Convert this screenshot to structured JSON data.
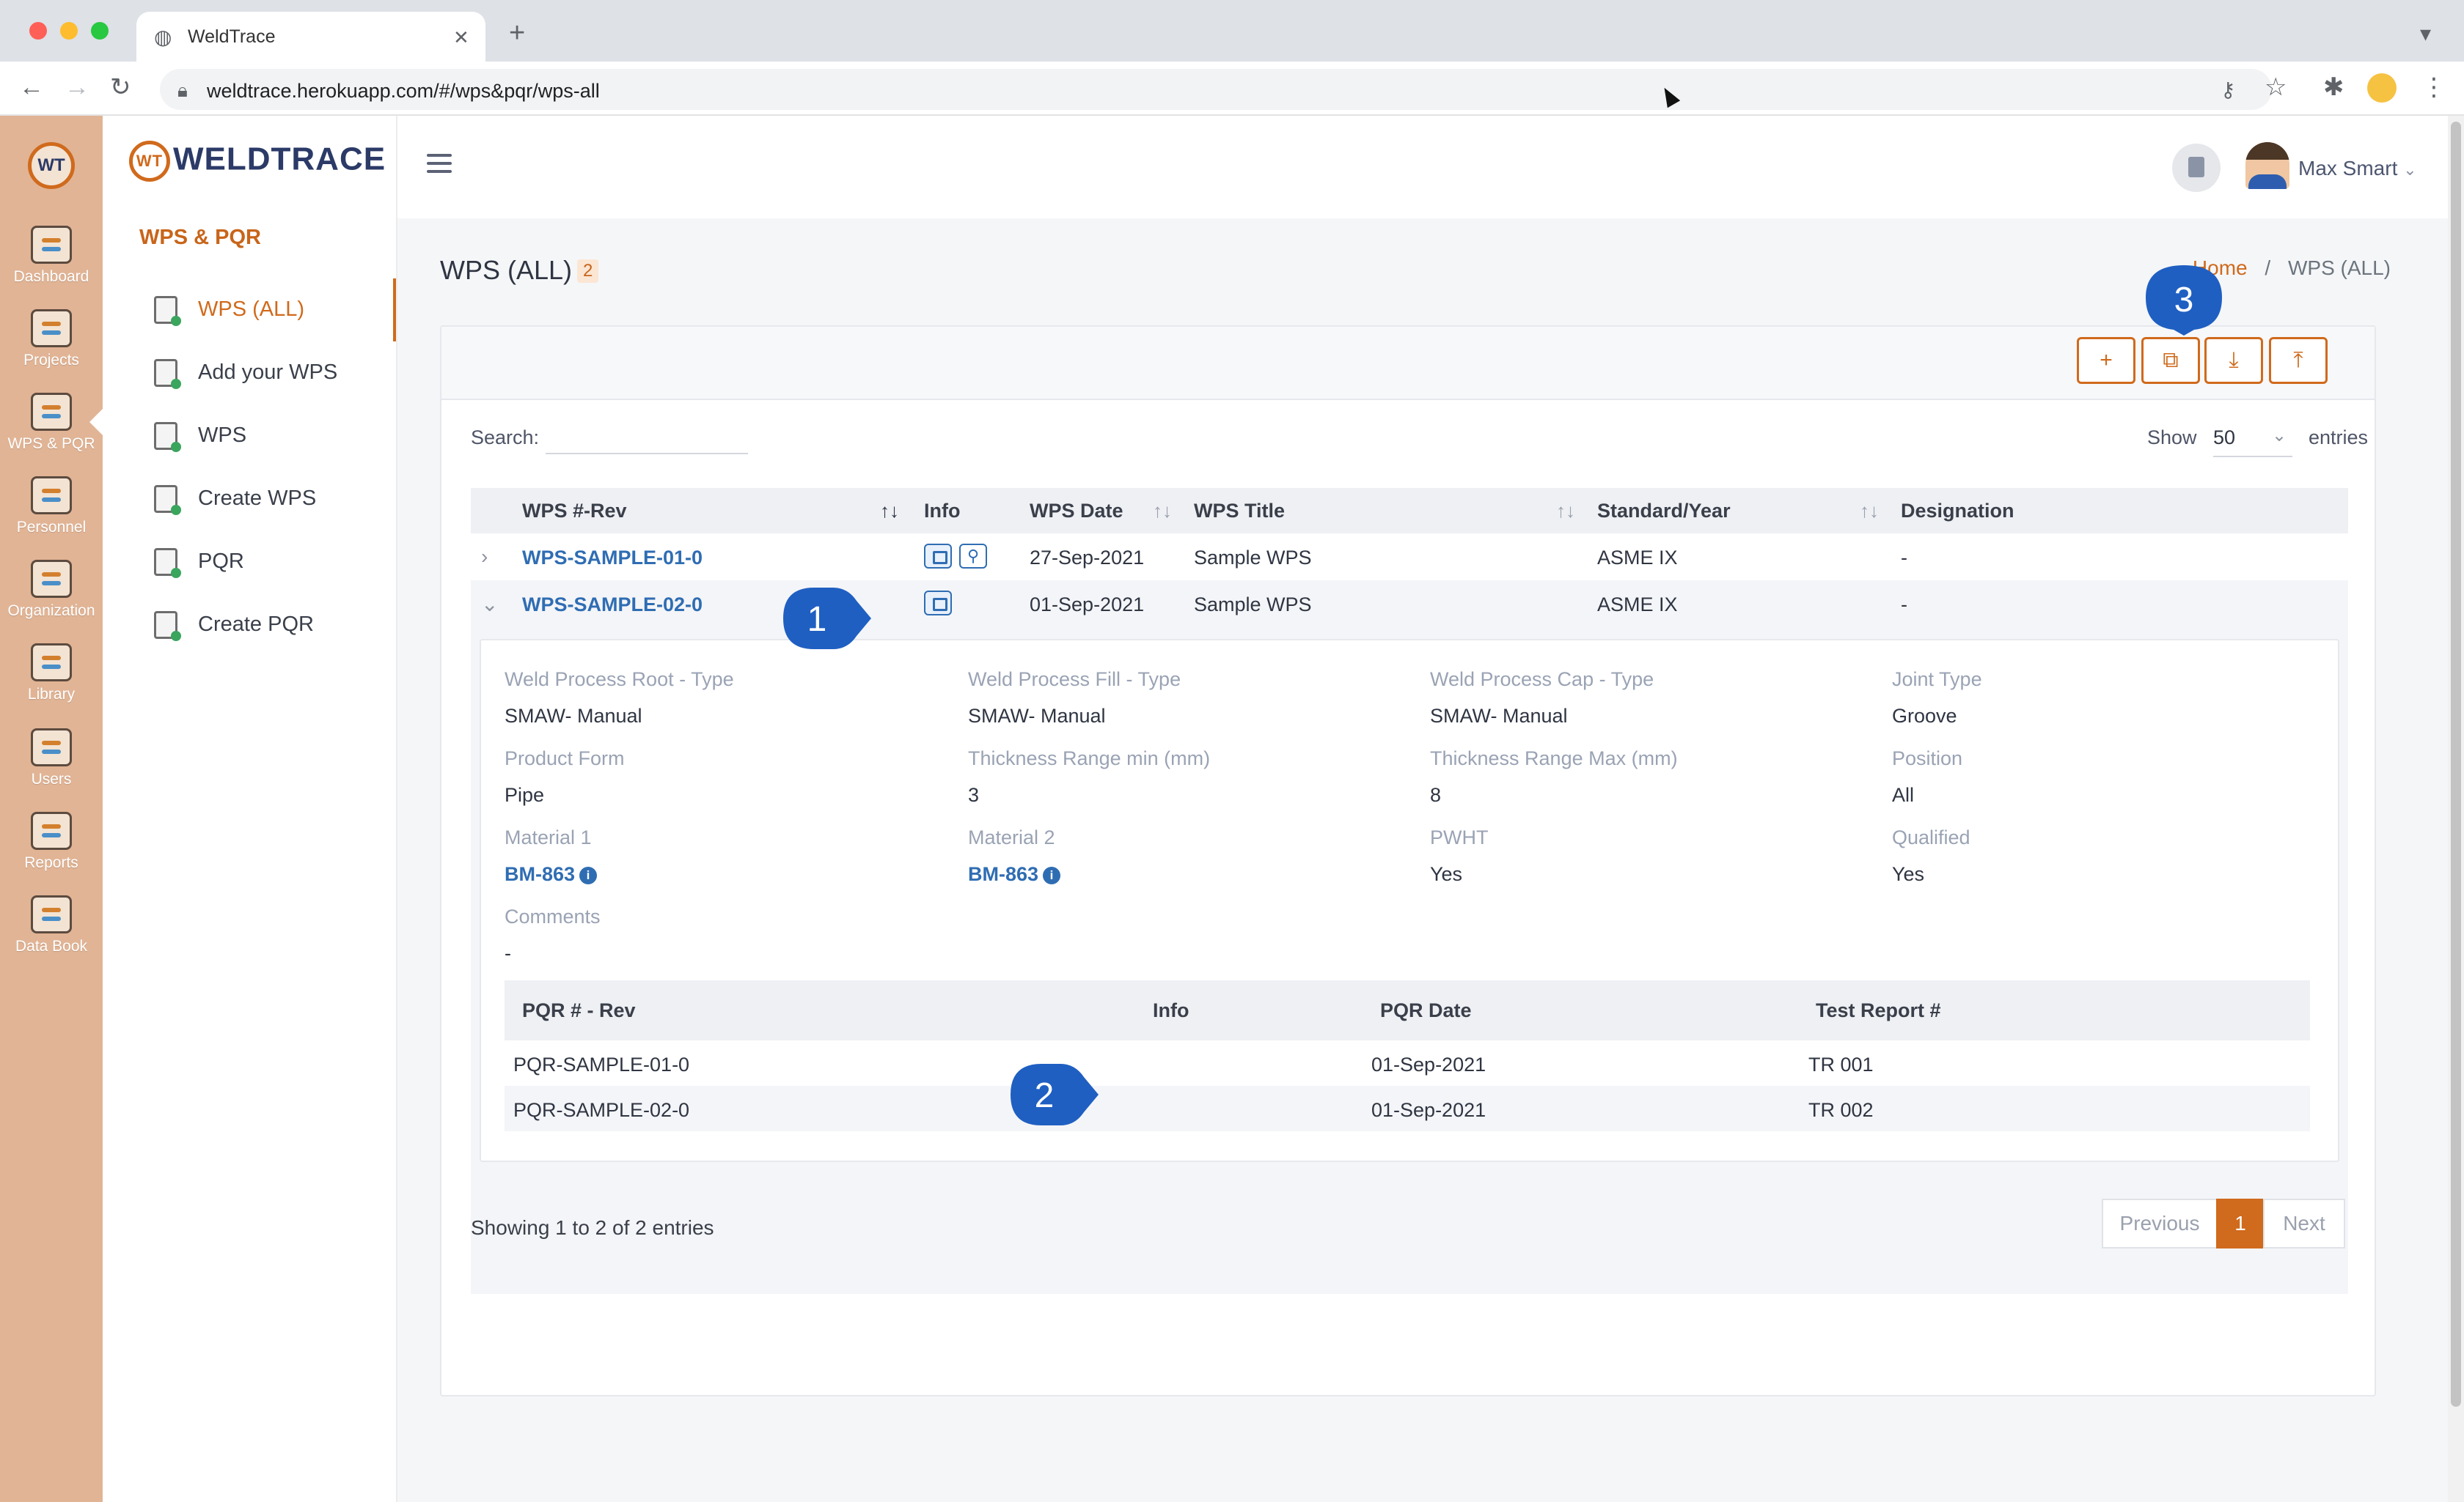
{
  "browser": {
    "tab_title": "WeldTrace",
    "url": "weldtrace.herokuapp.com/#/wps&pqr/wps-all",
    "new_tab_symbol": "+",
    "tab_close_symbol": "✕"
  },
  "rail": {
    "items": [
      {
        "label": "Dashboard",
        "icon": "dashboard-icon"
      },
      {
        "label": "Projects",
        "icon": "projects-icon"
      },
      {
        "label": "WPS & PQR",
        "icon": "wps-pqr-icon"
      },
      {
        "label": "Personnel",
        "icon": "personnel-icon"
      },
      {
        "label": "Organization",
        "icon": "organization-icon"
      },
      {
        "label": "Library",
        "icon": "library-icon"
      },
      {
        "label": "Users",
        "icon": "users-icon"
      },
      {
        "label": "Reports",
        "icon": "reports-icon"
      },
      {
        "label": "Data Book",
        "icon": "data-book-icon"
      }
    ]
  },
  "sidebar": {
    "logo_text": "WELDTRACE",
    "logo_mark": "WT",
    "section_title": "WPS & PQR",
    "items": [
      {
        "label": "WPS (ALL)",
        "active": true
      },
      {
        "label": "Add your WPS"
      },
      {
        "label": "WPS"
      },
      {
        "label": "Create WPS"
      },
      {
        "label": "PQR"
      },
      {
        "label": "Create PQR"
      }
    ]
  },
  "header": {
    "user_name": "Max Smart",
    "user_caret": "⌄"
  },
  "page": {
    "title": "WPS (ALL)",
    "count": "2",
    "breadcrumb_home": "Home",
    "breadcrumb_sep": "/",
    "breadcrumb_current": "WPS (ALL)"
  },
  "toolbar": {
    "buttons": [
      {
        "name": "add",
        "glyph": "+"
      },
      {
        "name": "copy",
        "glyph": "⧉"
      },
      {
        "name": "download",
        "glyph": "⤓"
      },
      {
        "name": "upload",
        "glyph": "⤒"
      }
    ]
  },
  "search": {
    "label": "Search:",
    "value": ""
  },
  "length": {
    "show_label": "Show",
    "value": "50",
    "entries_label": "entries"
  },
  "table": {
    "columns": [
      "WPS #-Rev",
      "Info",
      "WPS Date",
      "WPS Title",
      "Standard/Year",
      "Designation"
    ],
    "rows": [
      {
        "wps": "WPS-SAMPLE-01-0",
        "date": "27-Sep-2021",
        "title": "Sample WPS",
        "standard": "ASME IX",
        "designation": "-",
        "expanded": false
      },
      {
        "wps": "WPS-SAMPLE-02-0",
        "date": "01-Sep-2021",
        "title": "Sample WPS",
        "standard": "ASME IX",
        "designation": "-",
        "expanded": true
      }
    ]
  },
  "detail": {
    "fields": [
      {
        "label": "Weld Process Root - Type",
        "value": "SMAW- Manual"
      },
      {
        "label": "Weld Process Fill - Type",
        "value": "SMAW- Manual"
      },
      {
        "label": "Weld Process Cap - Type",
        "value": "SMAW- Manual"
      },
      {
        "label": "Joint Type",
        "value": "Groove"
      },
      {
        "label": "Product Form",
        "value": "Pipe"
      },
      {
        "label": "Thickness Range min (mm)",
        "value": "3"
      },
      {
        "label": "Thickness Range Max (mm)",
        "value": "8"
      },
      {
        "label": "Position",
        "value": "All"
      },
      {
        "label": "Material 1",
        "value": "BM-863"
      },
      {
        "label": "Material 2",
        "value": "BM-863"
      },
      {
        "label": "PWHT",
        "value": "Yes"
      },
      {
        "label": "Qualified",
        "value": "Yes"
      },
      {
        "label": "Comments",
        "value": "-"
      }
    ],
    "pqr_columns": [
      "PQR # - Rev",
      "Info",
      "PQR Date",
      "Test Report #"
    ],
    "pqr_rows": [
      {
        "pqr": "PQR-SAMPLE-01-0",
        "date": "01-Sep-2021",
        "report": "TR 001"
      },
      {
        "pqr": "PQR-SAMPLE-02-0",
        "date": "01-Sep-2021",
        "report": "TR 002"
      }
    ]
  },
  "footer": {
    "showing": "Showing 1 to 2 of 2 entries",
    "previous": "Previous",
    "page": "1",
    "next": "Next"
  },
  "markers": [
    "1",
    "2",
    "3"
  ],
  "colors": {
    "accent": "#d06a1c",
    "link": "#2f6db3",
    "rail": "#e1b495",
    "marker": "#1f5fc2"
  }
}
